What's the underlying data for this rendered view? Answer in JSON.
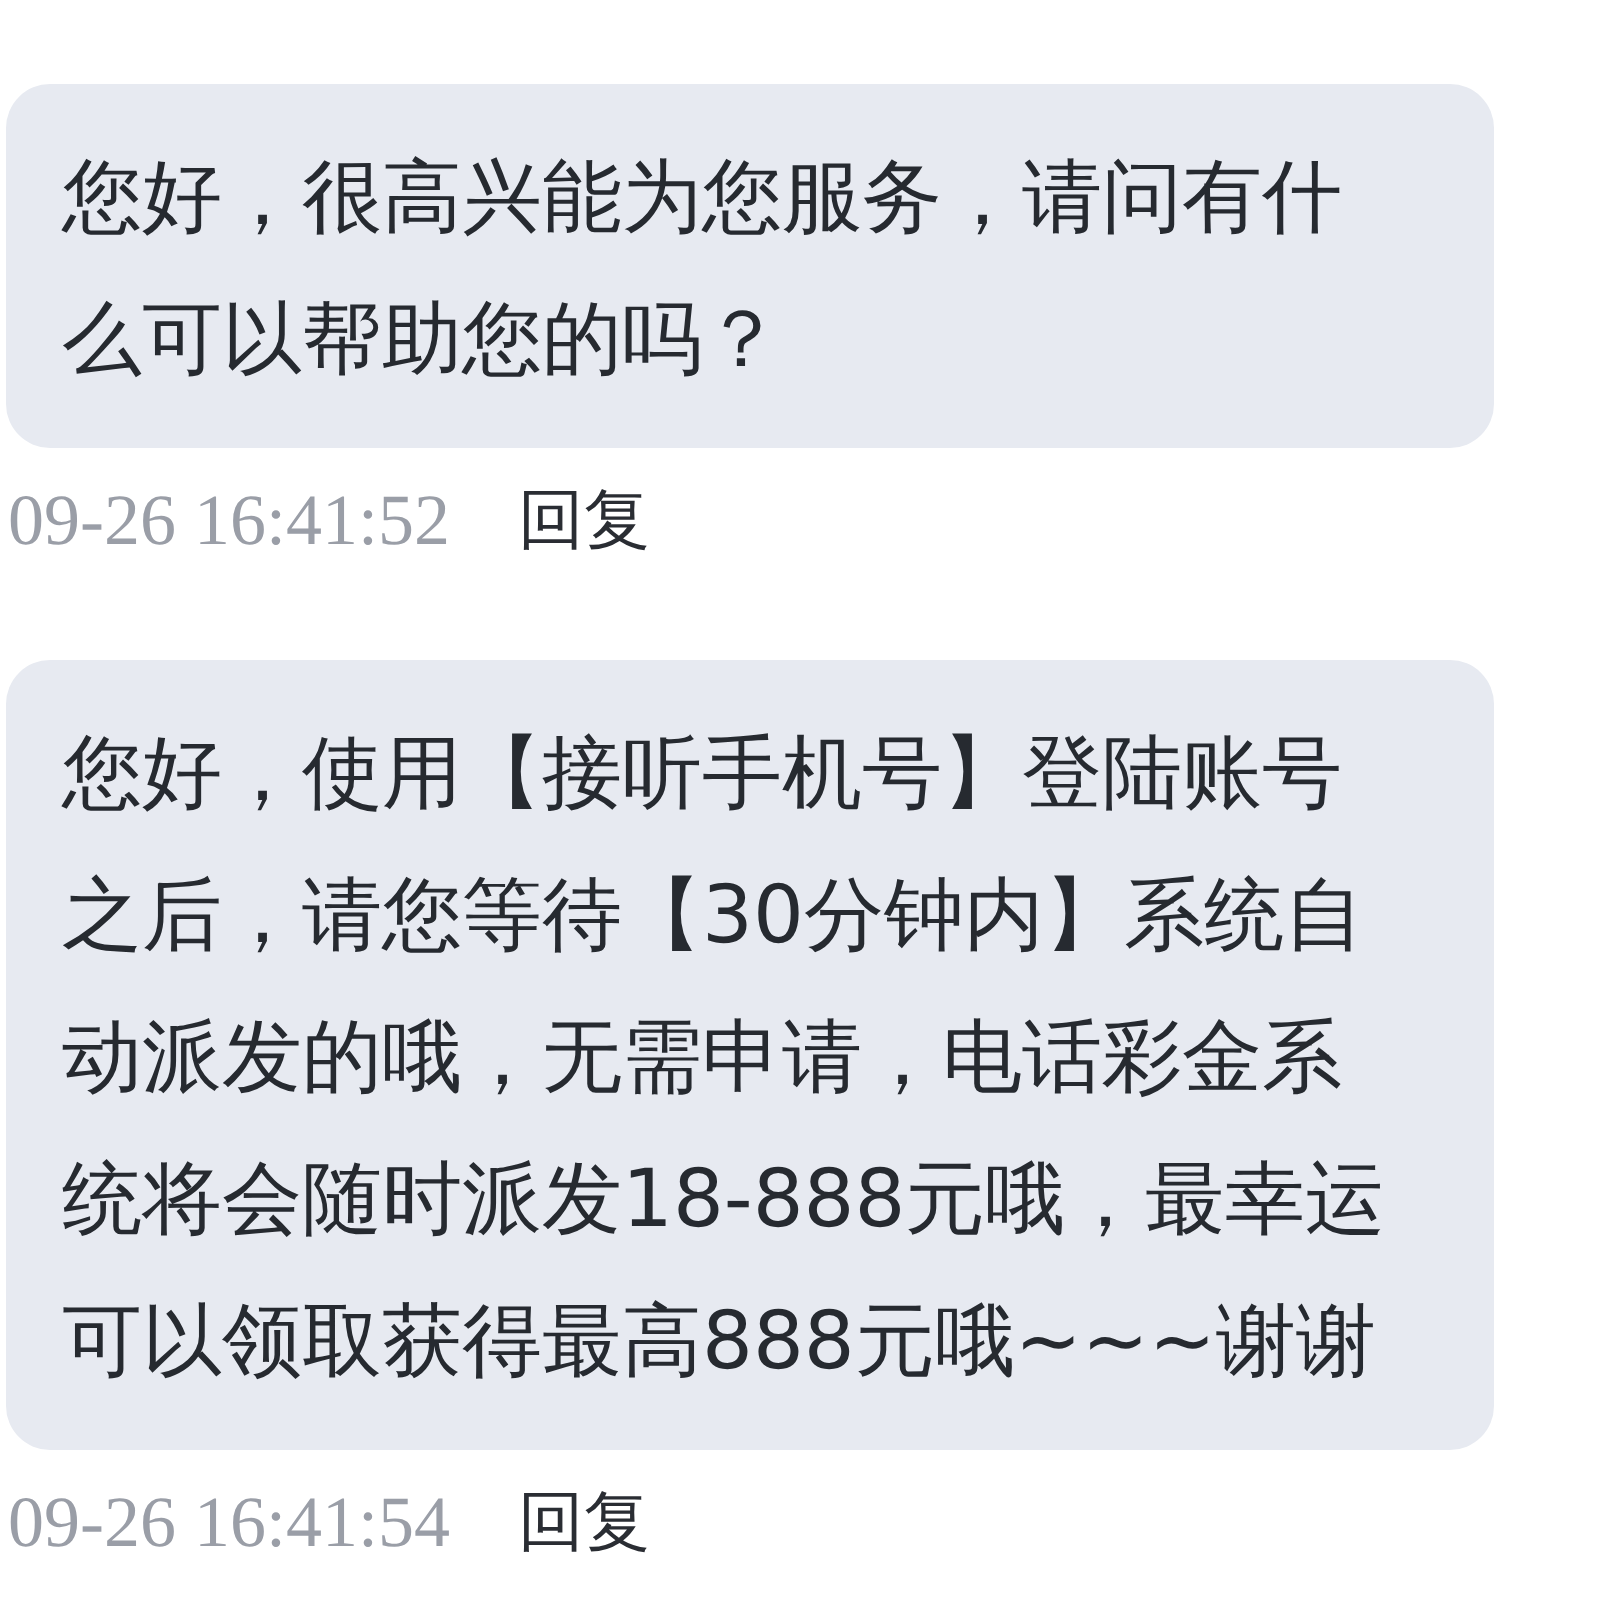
{
  "messages": [
    {
      "text": "您好，很高兴能为您服务，请问有什么可以帮助您的吗？",
      "time": "09-26 16:41:52",
      "reply": "回复"
    },
    {
      "text": "您好，使用【接听手机号】登陆账号之后，请您等待【30分钟内】系统自动派发的哦，无需申请，电话彩金系统将会随时派发18-888元哦，最幸运可以领取获得最高888元哦~~~谢谢",
      "time": "09-26 16:41:54",
      "reply": "回复"
    }
  ]
}
